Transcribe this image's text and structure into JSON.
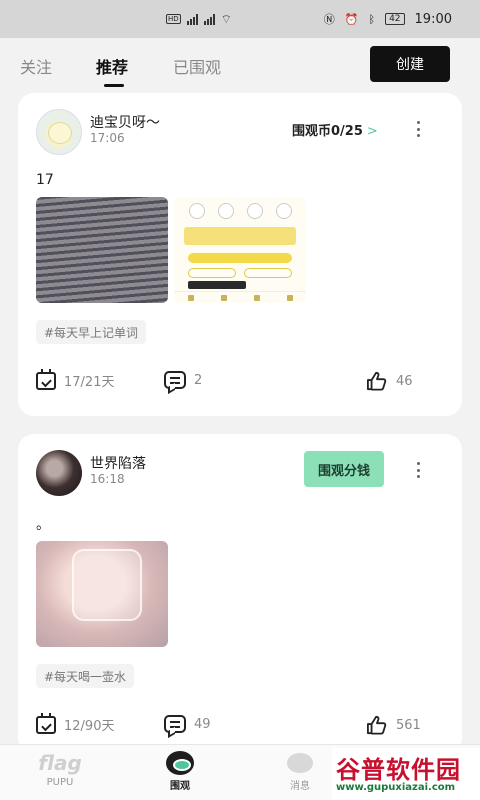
{
  "status_bar": {
    "time": "19:00",
    "battery": "42"
  },
  "top_tabs": {
    "items": [
      {
        "label": "关注"
      },
      {
        "label": "推荐"
      },
      {
        "label": "已围观"
      }
    ],
    "active_index": 1,
    "create_label": "创建"
  },
  "posts": [
    {
      "username": "迪宝贝呀～",
      "time": "17:06",
      "coin_label": "围观币0/25",
      "coin_arrow": ">",
      "text": "17",
      "tag": "#每天早上记单词",
      "days": "17/21天",
      "comments": "2",
      "likes": "46"
    },
    {
      "username": "世界陷落",
      "time": "16:18",
      "action_label": "围观分钱",
      "text": "。",
      "tag": "#每天喝一壶水",
      "days": "12/90天",
      "comments": "49",
      "likes": "561"
    }
  ],
  "bottom_nav": {
    "items": [
      {
        "logo": "flag",
        "label": "PUPU"
      },
      {
        "label": "围观"
      },
      {
        "label": "消息"
      }
    ],
    "active_index": 1
  },
  "watermark": {
    "title": "谷普软件园",
    "url": "www.gupuxiazai.com"
  },
  "colors": {
    "accent": "#4ec7a0",
    "action_button": "#8ce0b7",
    "create_button": "#111111"
  }
}
